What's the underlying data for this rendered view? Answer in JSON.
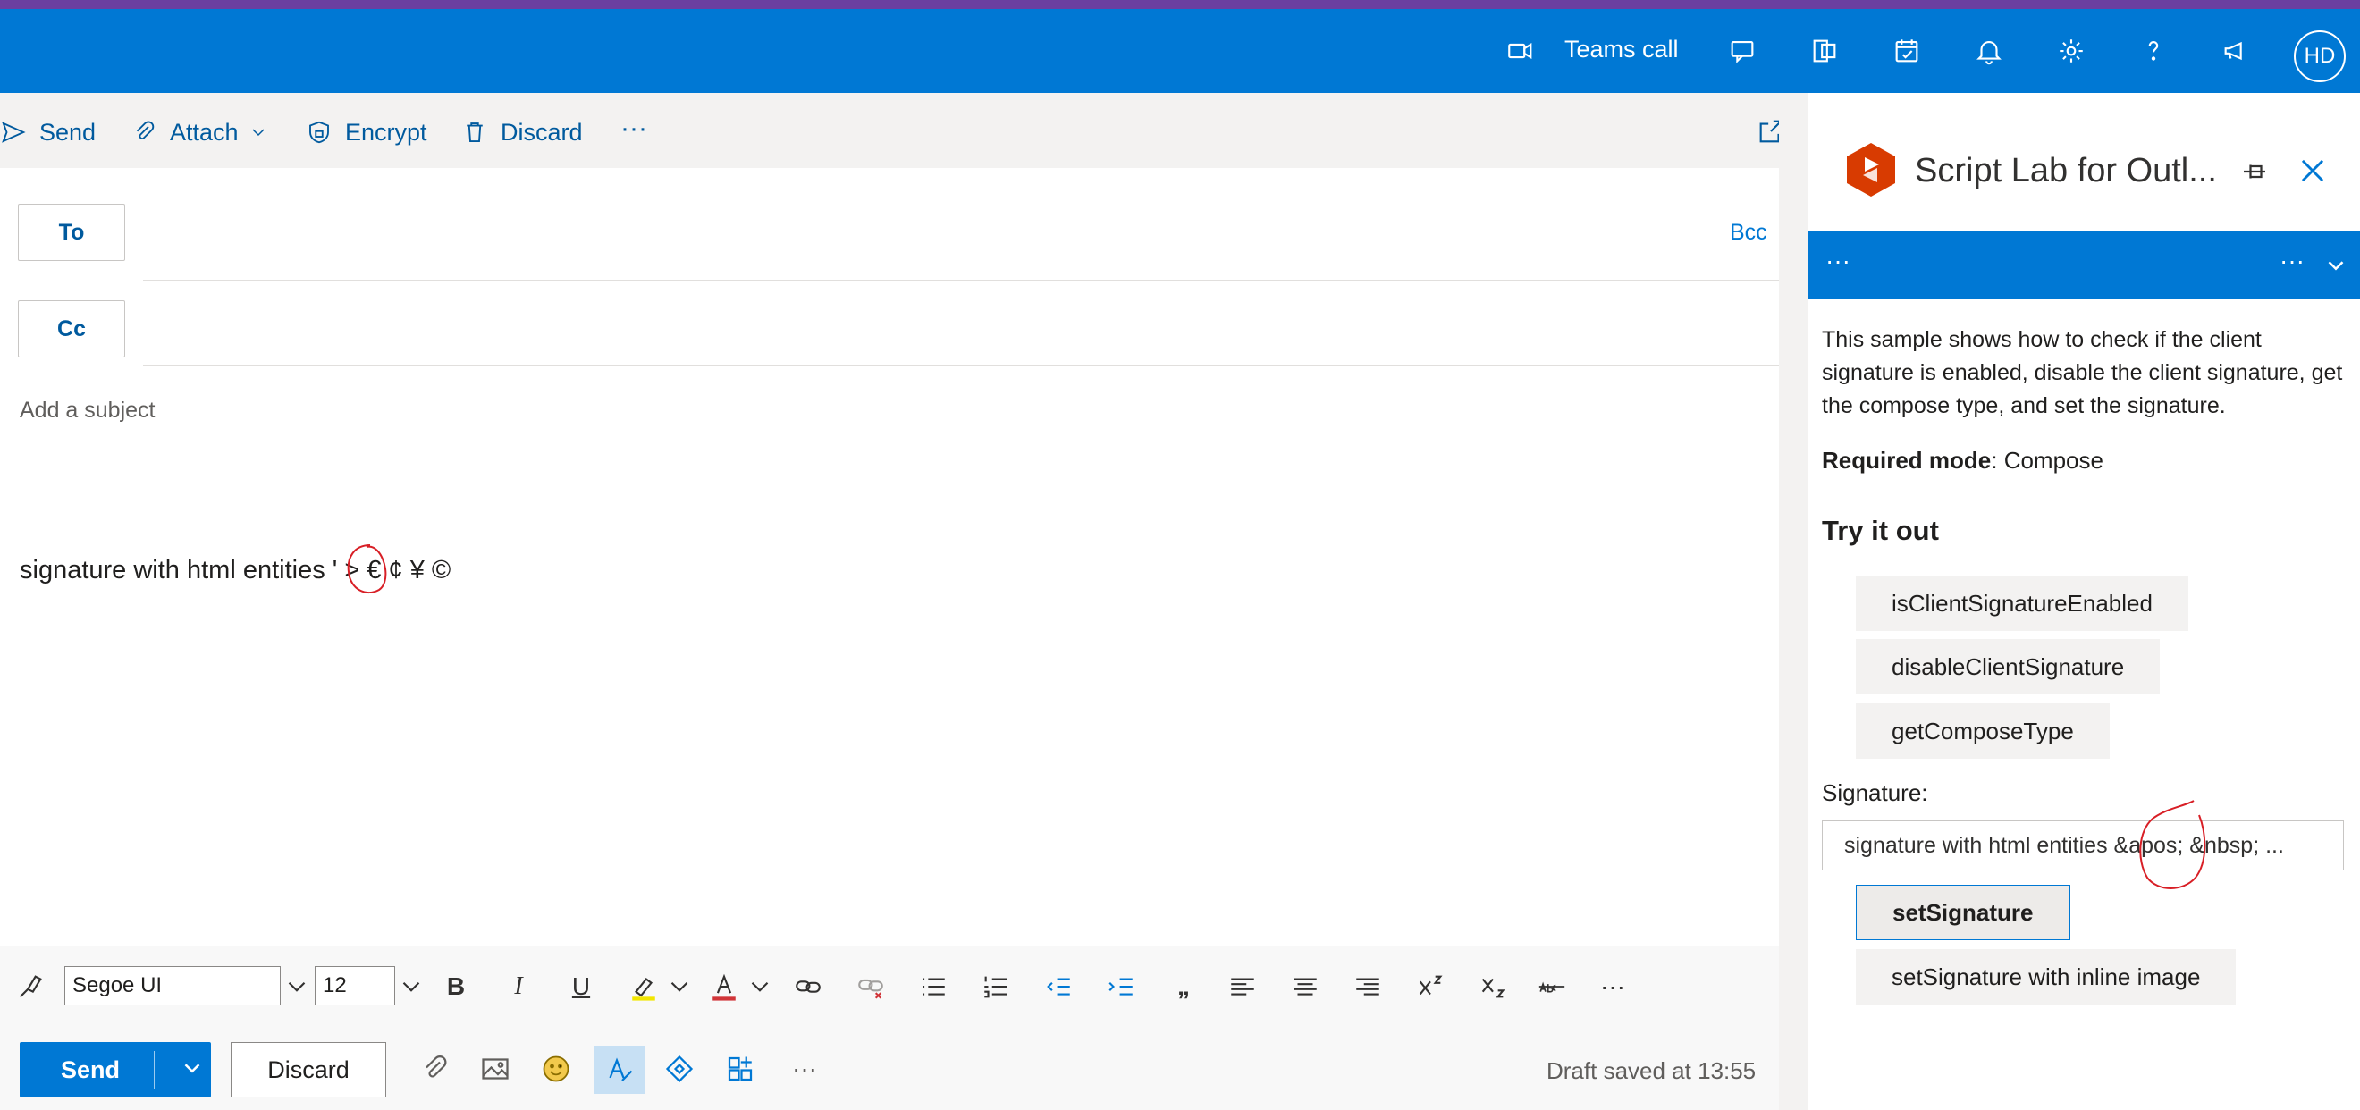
{
  "header": {
    "teams_call_label": "Teams call",
    "avatar_initials": "HD",
    "bar_color": "#0078d4"
  },
  "toolbar": {
    "send": "Send",
    "attach": "Attach",
    "encrypt": "Encrypt",
    "discard": "Discard",
    "more": "···"
  },
  "compose": {
    "to_label": "To",
    "cc_label": "Cc",
    "bcc_label": "Bcc",
    "subject_placeholder": "Add a subject",
    "body": "signature with html entities ' > € ¢ ¥ ©"
  },
  "format": {
    "font_name": "Segoe UI",
    "font_size": "12",
    "bold": "B",
    "italic": "I",
    "underline": "U",
    "quote": "„",
    "more": "···"
  },
  "footer": {
    "send": "Send",
    "discard": "Discard",
    "more": "···",
    "draft_status": "Draft saved at 13:55"
  },
  "scriptlab": {
    "title": "Script Lab for Outl...",
    "header_left": "···",
    "header_right": "···",
    "description": "This sample shows how to check if the client signature is enabled, disable the client signature, get the compose type, and set the signature.",
    "required_label": "Required mode",
    "required_value": ": Compose",
    "try_heading": "Try it out",
    "buttons": [
      "isClientSignatureEnabled",
      "disableClientSignature",
      "getComposeType"
    ],
    "signature_label": "Signature:",
    "signature_value": "signature with html entities &apos; &nbsp; ...",
    "set_signature": "setSignature",
    "set_signature_inline": "setSignature with inline image"
  }
}
